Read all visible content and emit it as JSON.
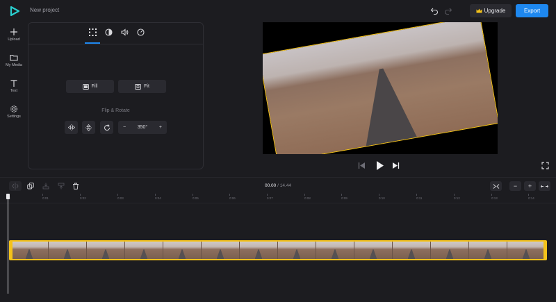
{
  "header": {
    "project_title": "New project",
    "upgrade_label": "Upgrade",
    "export_label": "Export",
    "accent_color": "#1e88f0",
    "highlight_color": "#f4c21a"
  },
  "sidebar": {
    "items": [
      {
        "label": "Upload",
        "icon": "plus-icon"
      },
      {
        "label": "My Media",
        "icon": "folder-icon"
      },
      {
        "label": "Text",
        "icon": "text-icon"
      },
      {
        "label": "Settings",
        "icon": "gear-icon"
      }
    ]
  },
  "panel": {
    "tabs": [
      "crop-tab",
      "filters-tab",
      "audio-tab",
      "speed-tab"
    ],
    "fill_label": "Fill",
    "fit_label": "Fit",
    "section_label": "Flip & Rotate",
    "rotation_value": "350°",
    "minus": "−",
    "plus": "+"
  },
  "timeline": {
    "current_time": "00.00",
    "separator": " / ",
    "total_time": "14.44",
    "ticks": [
      "0",
      "0:01",
      "0:02",
      "0:03",
      "0:04",
      "0:05",
      "0:06",
      "0:07",
      "0:08",
      "0:09",
      "0:10",
      "0:11",
      "0:12",
      "0:13",
      "0:14"
    ],
    "zoom_minus": "−",
    "zoom_plus": "+"
  }
}
